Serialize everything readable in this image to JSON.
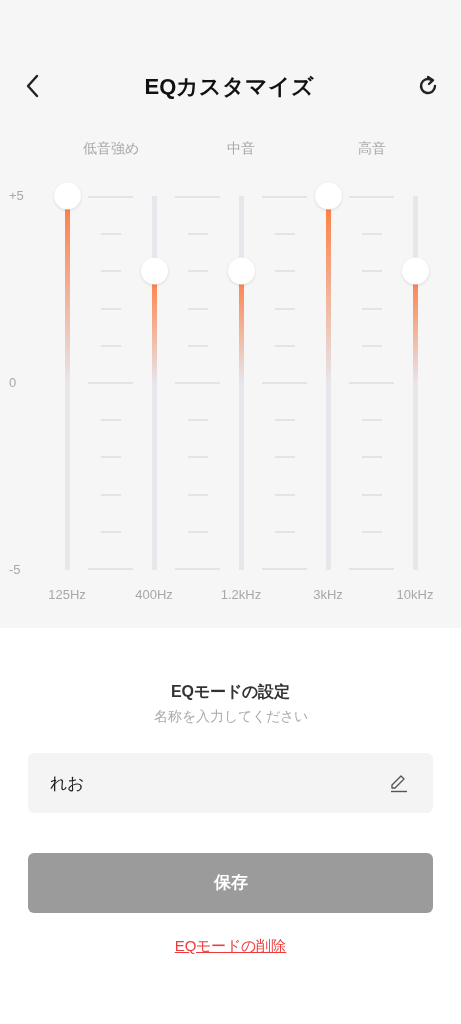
{
  "header": {
    "title": "EQカスタマイズ"
  },
  "band_groups": [
    "低音強め",
    "中音",
    "高音"
  ],
  "scale": [
    "+5",
    "0",
    "-5"
  ],
  "bands": [
    {
      "frequency": "125Hz",
      "level": 1
    },
    {
      "frequency": "400Hz",
      "level": 0.8
    },
    {
      "frequency": "1.2kHz",
      "level": 0.8
    },
    {
      "frequency": "3kHz",
      "level": 1
    },
    {
      "frequency": "10kHz",
      "level": 0.8
    }
  ],
  "mode": {
    "title": "EQモードの設定",
    "subtitle": "名称を入力してください",
    "name_field": {
      "value": "れお"
    },
    "save_button": "保存",
    "delete_link": "EQモードの削除"
  }
}
